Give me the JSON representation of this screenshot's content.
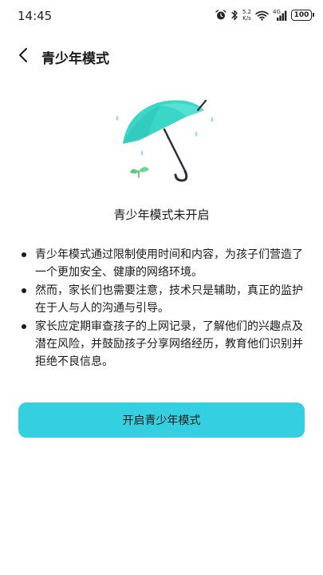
{
  "status_bar": {
    "time": "14:45",
    "net_speed_value": "5.2",
    "net_speed_unit": "K/s",
    "network_type": "4G",
    "battery": "100",
    "icons": [
      "alarm-icon",
      "bluetooth-icon",
      "wifi-icon",
      "signal-icon",
      "battery-icon"
    ]
  },
  "header": {
    "title": "青少年模式",
    "back_icon": "chevron-left-icon"
  },
  "illustration": {
    "icon": "umbrella-with-sprout-illustration",
    "colors": {
      "umbrella": "#3ad6c8",
      "drops": "#9ad8f5",
      "sprout": "#5cc87a",
      "handle": "#2c2f3a"
    }
  },
  "main": {
    "status_text": "青少年模式未开启",
    "tips": [
      "青少年模式通过限制使用时间和内容，为孩子们营造了一个更加安全、健康的网络环境。",
      "然而，家长们也需要注意，技术只是辅助，真正的监护在于人与人的沟通与引导。",
      "家长应定期审查孩子的上网记录，了解他们的兴趣点及潜在风险，并鼓励孩子分享网络经历，教育他们识别并拒绝不良信息。"
    ],
    "enable_button_label": "开启青少年模式",
    "accent_color": "#34cfe0"
  }
}
